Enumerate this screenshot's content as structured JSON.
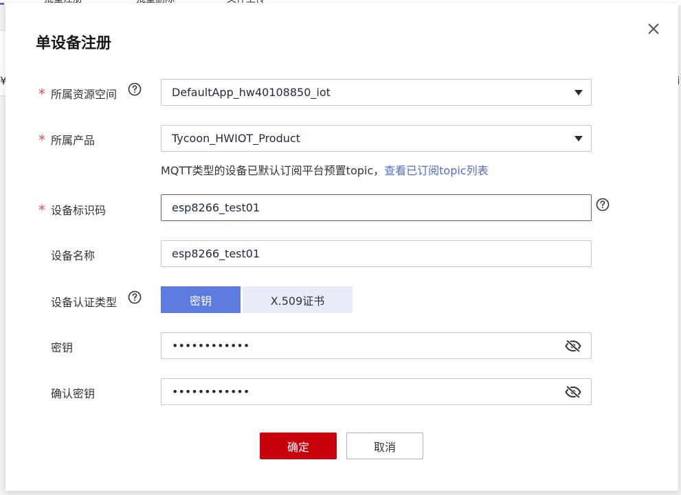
{
  "background": {
    "tabs": [
      "批量注册",
      "批量删除",
      "文件上传"
    ],
    "edge_left_char": "¥",
    "edge_right_char": "i"
  },
  "dialog": {
    "title": "单设备注册",
    "close_icon": "close-icon"
  },
  "form": {
    "resource_space": {
      "label": "所属资源空间",
      "required": "*",
      "value": "DefaultApp_hw40108850_iot"
    },
    "product": {
      "label": "所属产品",
      "required": "*",
      "value": "Tycoon_HWIOT_Product",
      "hint": "MQTT类型的设备已默认订阅平台预置topic，",
      "hint_link": "查看已订阅topic列表"
    },
    "device_id": {
      "label": "设备标识码",
      "required": "*",
      "value": "esp8266_test01"
    },
    "device_name": {
      "label": "设备名称",
      "value": "esp8266_test01"
    },
    "auth_type": {
      "label": "设备认证类型",
      "options": [
        "密钥",
        "X.509证书"
      ],
      "selected": "密钥"
    },
    "secret": {
      "label": "密钥",
      "value": "••••••••••••"
    },
    "confirm_secret": {
      "label": "确认密钥",
      "value": "••••••••••••"
    }
  },
  "buttons": {
    "ok": "确定",
    "cancel": "取消"
  },
  "colors": {
    "accent": "#5e7ce0",
    "link": "#526ecc",
    "primary_button": "#c7000b",
    "required": "#e84e40"
  }
}
